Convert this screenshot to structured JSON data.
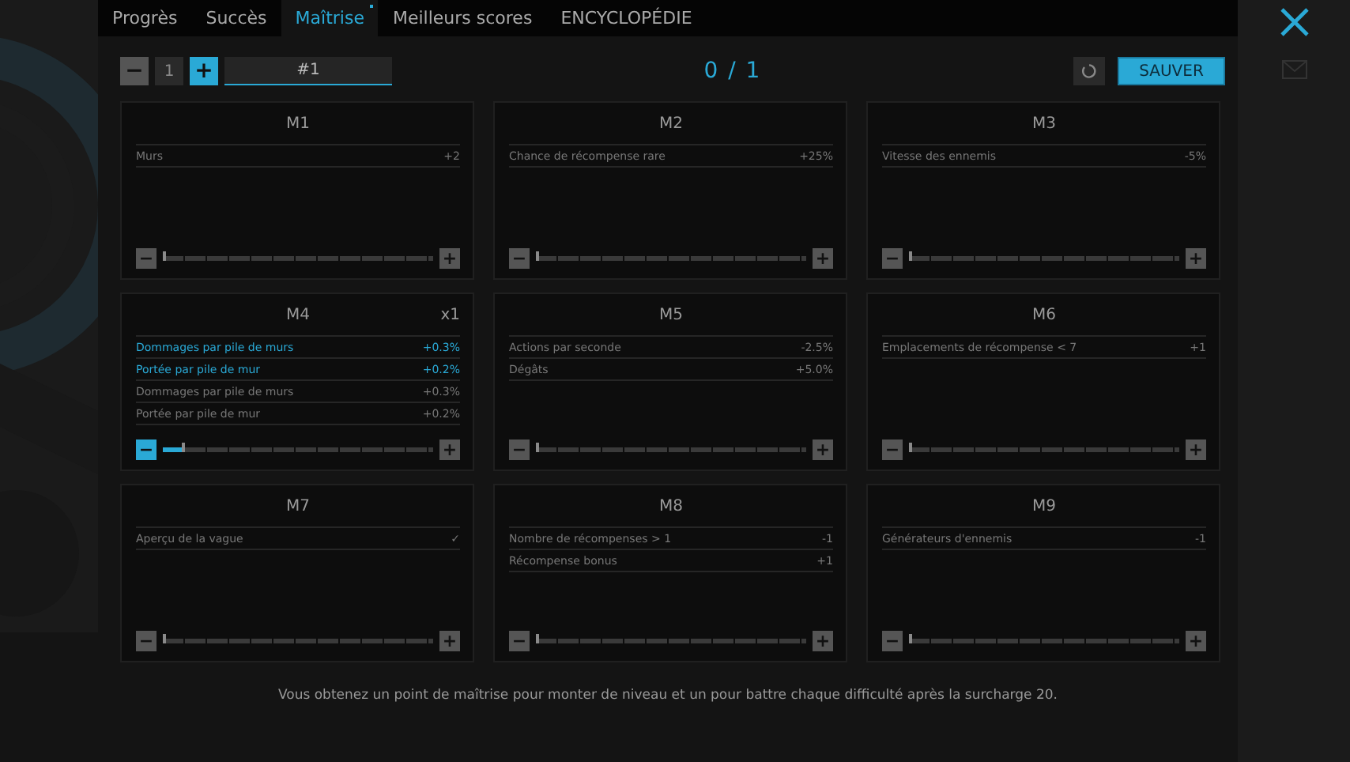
{
  "tabs": [
    {
      "label": "Progrès",
      "selected": false,
      "dot": false
    },
    {
      "label": "Succès",
      "selected": false,
      "dot": false
    },
    {
      "label": "Maîtrise",
      "selected": true,
      "dot": true
    },
    {
      "label": "Meilleurs scores",
      "selected": false,
      "dot": false
    },
    {
      "label": "ENCYCLOPÉDIE",
      "selected": false,
      "dot": false
    }
  ],
  "toolbar": {
    "minus": "−",
    "count": "1",
    "plus": "+",
    "name": "#1",
    "score": "0 / 1",
    "save": "SAUVER"
  },
  "cards": [
    {
      "title": "M1",
      "level": 0,
      "rows": [
        {
          "label": "Murs",
          "value": "+2",
          "active": false
        }
      ]
    },
    {
      "title": "M2",
      "level": 0,
      "rows": [
        {
          "label": "Chance de récompense rare",
          "value": "+25%",
          "active": false
        }
      ]
    },
    {
      "title": "M3",
      "level": 0,
      "rows": [
        {
          "label": "Vitesse des ennemis",
          "value": "-5%",
          "active": false
        }
      ]
    },
    {
      "title": "M4",
      "multiplier": "x1",
      "level": 0.07,
      "rows": [
        {
          "label": "Dommages par pile de murs",
          "value": "+0.3%",
          "active": true
        },
        {
          "label": "Portée par pile de mur",
          "value": "+0.2%",
          "active": true
        },
        {
          "label": "Dommages par pile de murs",
          "value": "+0.3%",
          "active": false
        },
        {
          "label": "Portée par pile de mur",
          "value": "+0.2%",
          "active": false
        }
      ]
    },
    {
      "title": "M5",
      "level": 0,
      "rows": [
        {
          "label": "Actions par seconde",
          "value": "-2.5%",
          "active": false
        },
        {
          "label": "Dégâts",
          "value": "+5.0%",
          "active": false
        }
      ]
    },
    {
      "title": "M6",
      "level": 0,
      "rows": [
        {
          "label": "Emplacements de récompense < 7",
          "value": "+1",
          "active": false
        }
      ]
    },
    {
      "title": "M7",
      "level": 0,
      "rows": [
        {
          "label": "Aperçu de la vague",
          "value": "✓",
          "active": false
        }
      ]
    },
    {
      "title": "M8",
      "level": 0,
      "rows": [
        {
          "label": "Nombre de récompenses > 1",
          "value": "-1",
          "active": false
        },
        {
          "label": "Récompense bonus",
          "value": "+1",
          "active": false
        }
      ]
    },
    {
      "title": "M9",
      "level": 0,
      "rows": [
        {
          "label": "Générateurs d'ennemis",
          "value": "-1",
          "active": false
        }
      ]
    }
  ],
  "footer": "Vous obtenez un point de maîtrise pour monter de niveau et un pour battre chaque difficulté après la surcharge 20."
}
